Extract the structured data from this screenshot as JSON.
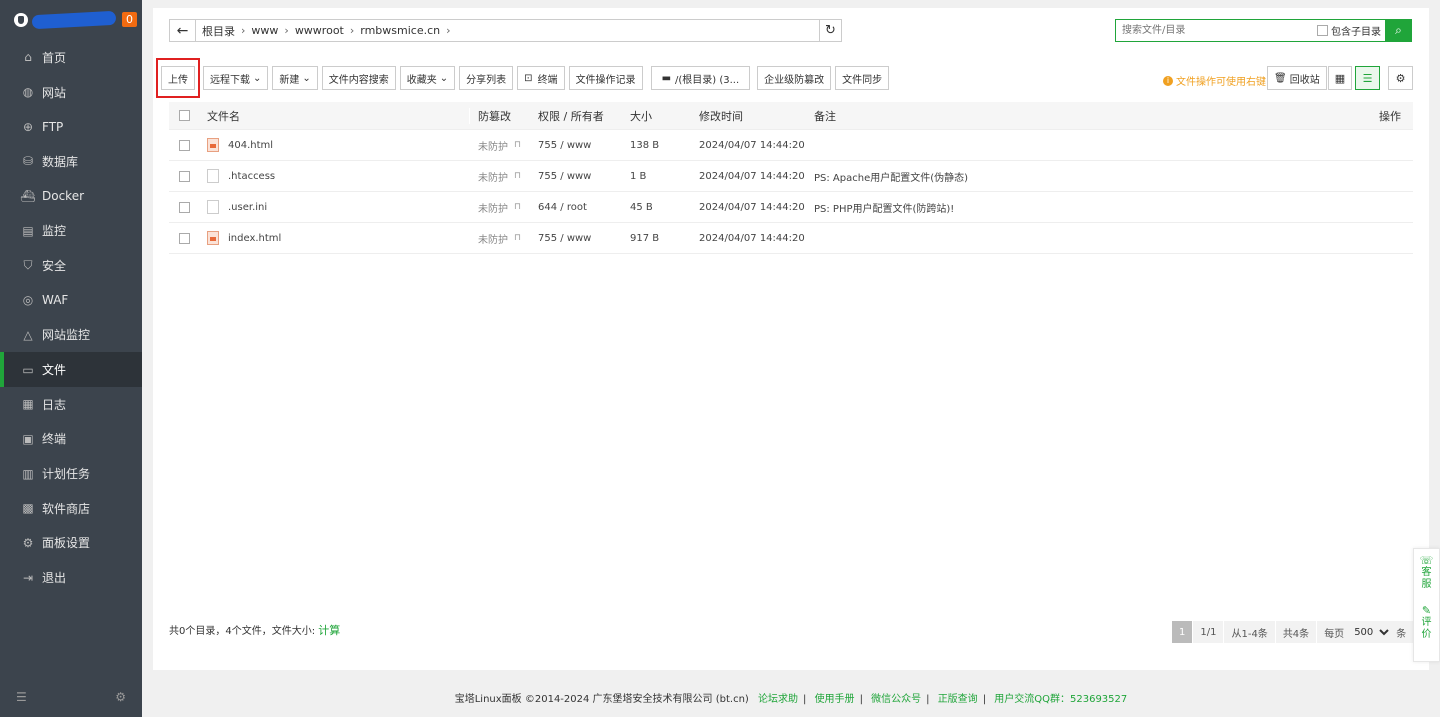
{
  "sidebar": {
    "badge": "0",
    "items": [
      {
        "label": "首页",
        "icon": "home-icon",
        "glyph": "⌂"
      },
      {
        "label": "网站",
        "icon": "globe-icon",
        "glyph": "◍"
      },
      {
        "label": "FTP",
        "icon": "ftp-icon",
        "glyph": "⊕"
      },
      {
        "label": "数据库",
        "icon": "database-icon",
        "glyph": "⛁"
      },
      {
        "label": "Docker",
        "icon": "docker-icon",
        "glyph": "⛴"
      },
      {
        "label": "监控",
        "icon": "monitor-icon",
        "glyph": "▤"
      },
      {
        "label": "安全",
        "icon": "shield-icon",
        "glyph": "⛉"
      },
      {
        "label": "WAF",
        "icon": "waf-icon",
        "glyph": "◎"
      },
      {
        "label": "网站监控",
        "icon": "site-monitor-icon",
        "glyph": "△"
      },
      {
        "label": "文件",
        "icon": "folder-icon",
        "glyph": "▭"
      },
      {
        "label": "日志",
        "icon": "log-icon",
        "glyph": "▦"
      },
      {
        "label": "终端",
        "icon": "terminal-icon",
        "glyph": "▣"
      },
      {
        "label": "计划任务",
        "icon": "task-icon",
        "glyph": "▥"
      },
      {
        "label": "软件商店",
        "icon": "store-icon",
        "glyph": "▩"
      },
      {
        "label": "面板设置",
        "icon": "gear-icon",
        "glyph": "⚙"
      },
      {
        "label": "退出",
        "icon": "logout-icon",
        "glyph": "⇥"
      }
    ]
  },
  "path": {
    "crumbs": [
      "根目录",
      "www",
      "wwwroot",
      "rmbwsmice.cn"
    ]
  },
  "search": {
    "placeholder": "搜索文件/目录",
    "subdir_label": "包含子目录"
  },
  "toolbar": {
    "upload": "上传",
    "remote_download": "远程下载",
    "new": "新建",
    "content_search": "文件内容搜索",
    "favorites": "收藏夹",
    "share_list": "分享列表",
    "terminal": "终端",
    "op_log": "文件操作记录",
    "disk": "/(根目录) (3...",
    "tamper": "企业级防篡改",
    "sync": "文件同步",
    "hint": "文件操作可使用右键",
    "recycle": "回收站"
  },
  "table": {
    "headers": {
      "name": "文件名",
      "protect": "防篡改",
      "perm": "权限 / 所有者",
      "size": "大小",
      "mtime": "修改时间",
      "note": "备注",
      "op": "操作"
    },
    "rows": [
      {
        "name": "404.html",
        "type": "html",
        "protect": "未防护",
        "perm": "755 / www",
        "size": "138 B",
        "mtime": "2024/04/07 14:44:20",
        "note": ""
      },
      {
        "name": ".htaccess",
        "type": "file",
        "protect": "未防护",
        "perm": "755 / www",
        "size": "1 B",
        "mtime": "2024/04/07 14:44:20",
        "note": "PS: Apache用户配置文件(伪静态)"
      },
      {
        "name": ".user.ini",
        "type": "file",
        "protect": "未防护",
        "perm": "644 / root",
        "size": "45 B",
        "mtime": "2024/04/07 14:44:20",
        "note": "PS: PHP用户配置文件(防跨站)!"
      },
      {
        "name": "index.html",
        "type": "html",
        "protect": "未防护",
        "perm": "755 / www",
        "size": "917 B",
        "mtime": "2024/04/07 14:44:20",
        "note": ""
      }
    ]
  },
  "summary": {
    "text": "共0个目录，4个文件，文件大小:",
    "calc": "计算"
  },
  "pager": {
    "current": "1",
    "pages": "1/1",
    "range": "从1-4条",
    "total": "共4条",
    "per_page_label": "每页",
    "per_page": "500",
    "unit": "条"
  },
  "float": {
    "service": "客服",
    "review": "评价"
  },
  "footer": {
    "copyright": "宝塔Linux面板 ©2014-2024 广东堡塔安全技术有限公司 (bt.cn)",
    "forum": "论坛求助",
    "manual": "使用手册",
    "wechat": "微信公众号",
    "verify": "正版查询",
    "qq": "用户交流QQ群：523693527"
  },
  "colors": {
    "accent": "#20a53a",
    "sidebar": "#3c444d",
    "highlight_box": "#e02020"
  }
}
